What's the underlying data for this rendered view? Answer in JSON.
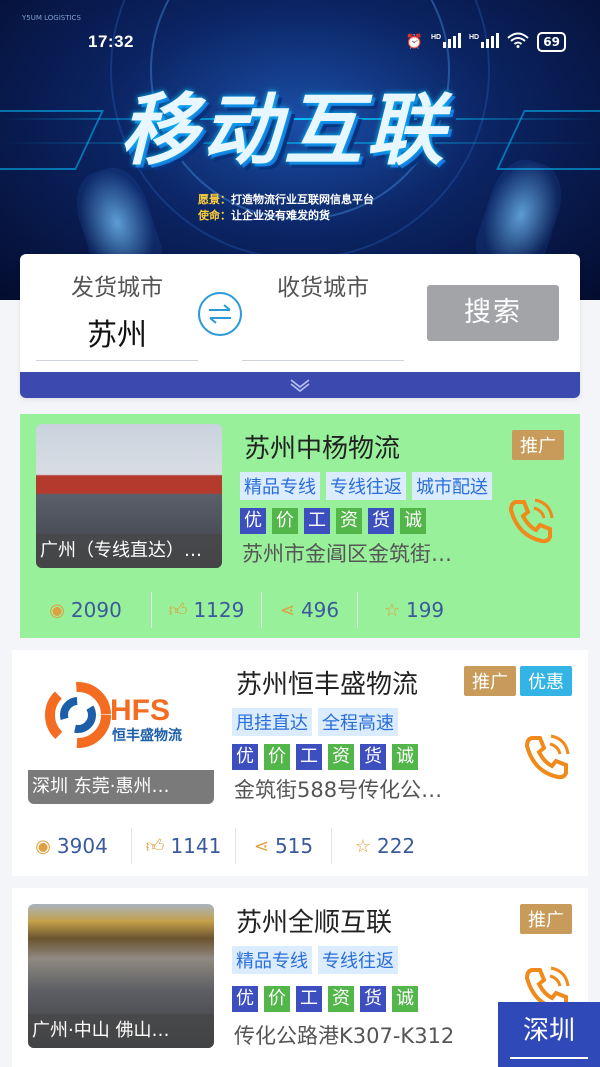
{
  "status_bar": {
    "time": "17:32",
    "battery": "69",
    "signal_icons": [
      "alarm-icon",
      "hd-signal-icon",
      "hd-signal-icon",
      "wifi-icon"
    ]
  },
  "banner": {
    "title": "移动互联",
    "line1_key": "愿景：",
    "line1_text": "打造物流行业互联网信息平台",
    "line2_key": "使命：",
    "line2_text": "让企业没有难发的货",
    "corner_text": "Y5UM LOGISTICS"
  },
  "search": {
    "from_label": "发货城市",
    "from_value": "苏州",
    "to_label": "收货城市",
    "to_value": "",
    "button_label": "搜索",
    "expand_icon": "chevron-down-icon"
  },
  "listings": [
    {
      "title": "苏州中杨物流",
      "badges": [
        "推广"
      ],
      "tags": [
        "精品专线",
        "专线往返",
        "城市配送"
      ],
      "quals": [
        "优",
        "价",
        "工",
        "资",
        "货",
        "诚"
      ],
      "address": "苏州市金阊区金筑街…",
      "caption": "广州（专线直达）…",
      "stats": {
        "views": "2090",
        "likes": "1129",
        "shares": "496",
        "favorites": "199"
      }
    },
    {
      "title": "苏州恒丰盛物流",
      "badges": [
        "推广",
        "优惠"
      ],
      "tags": [
        "甩挂直达",
        "全程高速"
      ],
      "quals": [
        "优",
        "价",
        "工",
        "资",
        "货",
        "诚"
      ],
      "address": "金筑街588号传化公…",
      "caption": "深圳  东莞·惠州…",
      "logo_text": "HFS",
      "logo_sub": "恒丰盛物流",
      "stats": {
        "views": "3904",
        "likes": "1141",
        "shares": "515",
        "favorites": "222"
      }
    },
    {
      "title": "苏州全顺互联",
      "badges": [
        "推广"
      ],
      "tags": [
        "精品专线",
        "专线往返"
      ],
      "quals": [
        "优",
        "价",
        "工",
        "资",
        "货",
        "诚"
      ],
      "address": "传化公路港K307-K312",
      "caption": "广州·中山  佛山…"
    }
  ],
  "float_city": "深圳",
  "colors": {
    "promo_bg": "#98f09b",
    "badge_promo": "#c89b5a",
    "badge_discount": "#34b4e4",
    "qual_colors": [
      "#3d4fbf",
      "#52b64a",
      "#3d4fbf",
      "#52b64a",
      "#3d4fbf",
      "#52b64a"
    ],
    "phone": "#f08a1c"
  }
}
